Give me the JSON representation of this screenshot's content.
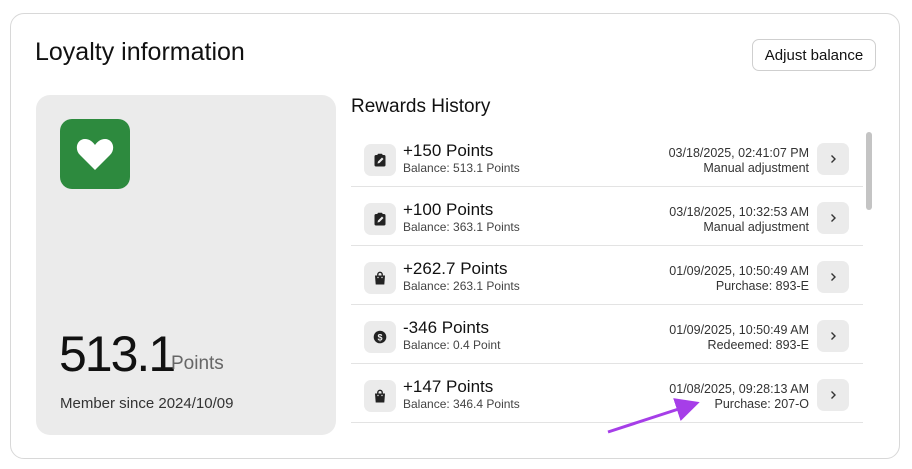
{
  "header": {
    "title": "Loyalty information",
    "adjust_label": "Adjust balance"
  },
  "summary": {
    "points_value": "513.1",
    "points_unit": "Points",
    "member_since": "Member since 2024/10/09",
    "logo_icon": "heart-icon",
    "logo_color": "#2d8a3e"
  },
  "history": {
    "title": "Rewards History",
    "rows": [
      {
        "icon": "clipboard-edit-icon",
        "points": "+150 Points",
        "balance": "Balance: 513.1 Points",
        "date": "03/18/2025, 02:41:07 PM",
        "type": "Manual adjustment"
      },
      {
        "icon": "clipboard-edit-icon",
        "points": "+100 Points",
        "balance": "Balance: 363.1 Points",
        "date": "03/18/2025, 10:32:53 AM",
        "type": "Manual adjustment"
      },
      {
        "icon": "shopping-bag-icon",
        "points": "+262.7 Points",
        "balance": "Balance: 263.1 Points",
        "date": "01/09/2025, 10:50:49 AM",
        "type": "Purchase: 893-E"
      },
      {
        "icon": "dollar-coin-icon",
        "points": "-346 Points",
        "balance": "Balance: 0.4 Point",
        "date": "01/09/2025, 10:50:49 AM",
        "type": "Redeemed: 893-E"
      },
      {
        "icon": "shopping-bag-icon",
        "points": "+147 Points",
        "balance": "Balance: 346.4 Points",
        "date": "01/08/2025, 09:28:13 AM",
        "type": "Purchase: 207-O"
      }
    ]
  },
  "annotation": {
    "arrow_color": "#a63ee8"
  }
}
